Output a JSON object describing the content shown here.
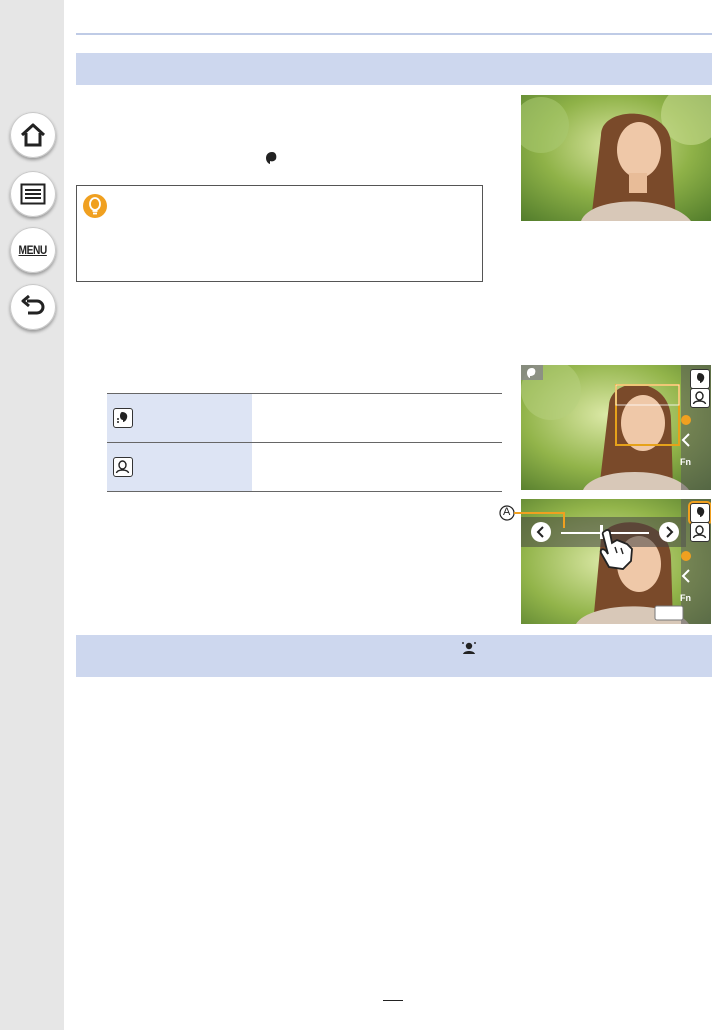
{
  "sidebar": {
    "items": [
      {
        "name": "home",
        "icon": "home-icon"
      },
      {
        "name": "contents",
        "icon": "list-icon"
      },
      {
        "name": "menu",
        "icon": "menu-icon",
        "label": "MENU"
      },
      {
        "name": "back",
        "icon": "back-arrow-icon"
      }
    ]
  },
  "section_band": {
    "title": ""
  },
  "lower_band": {
    "text": ""
  },
  "tip": {
    "icon": "lightbulb-icon",
    "text": ""
  },
  "mode_table": {
    "rows": [
      {
        "icon": "face-skin-icon",
        "description": ""
      },
      {
        "icon": "face-portrait-icon",
        "description": ""
      }
    ]
  },
  "viewfinder_1": {
    "mode_icon": "beauty-mode-icon",
    "side_icons": [
      "face-skin-icon",
      "face-portrait-icon"
    ],
    "side_label": "Fn"
  },
  "viewfinder_2": {
    "callout_label": "A",
    "side_icons": [
      "face-skin-icon",
      "face-portrait-icon"
    ],
    "side_label": "Fn",
    "slider_value": 0.45
  },
  "colors": {
    "sidebar": "#e6e6e6",
    "band": "#cdd7ee",
    "table_header": "#dde4f4",
    "accent_orange": "#f0a020",
    "face_frame": "#e6a21a"
  }
}
